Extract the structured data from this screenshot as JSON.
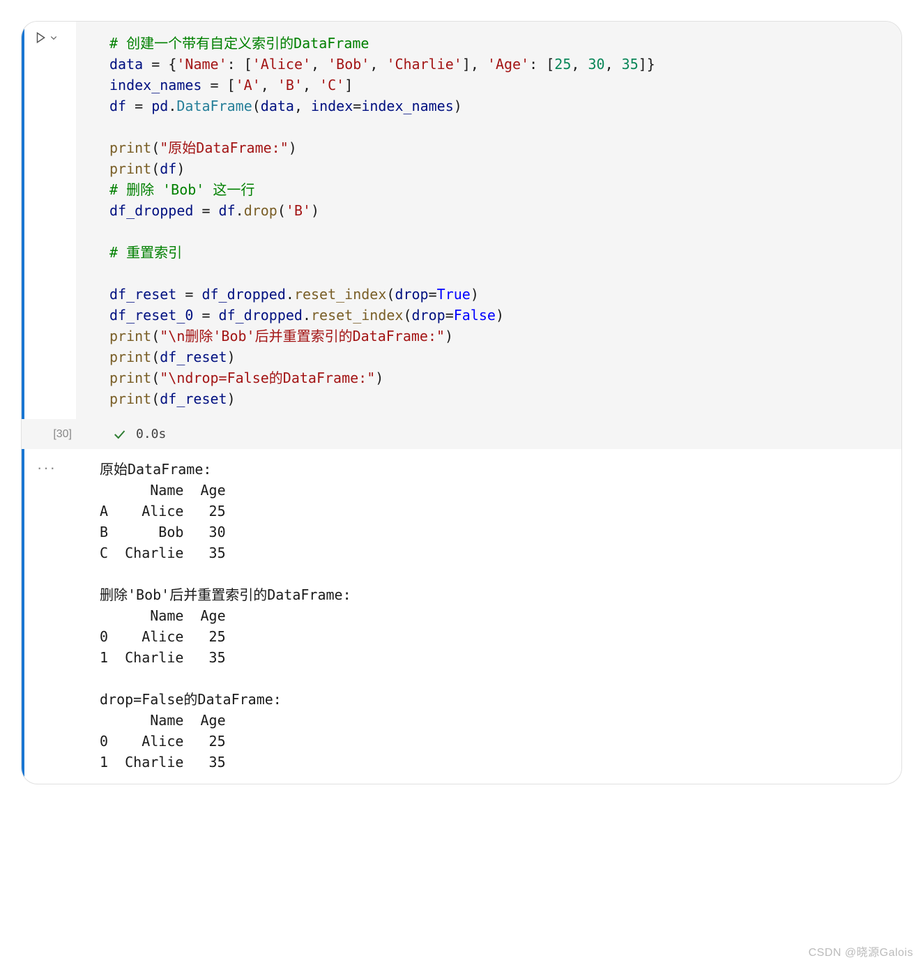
{
  "cell": {
    "exec_count": "[30]",
    "exec_time": "0.0s",
    "ellipsis": "···",
    "code_lines": [
      [
        {
          "t": "# 创建一个带有自定义索引的DataFrame",
          "c": "c-comment"
        }
      ],
      [
        {
          "t": "data ",
          "c": "c-attr"
        },
        {
          "t": "= ",
          "c": "c-op"
        },
        {
          "t": "{",
          "c": "c-punct"
        },
        {
          "t": "'Name'",
          "c": "c-str"
        },
        {
          "t": ": [",
          "c": "c-punct"
        },
        {
          "t": "'Alice'",
          "c": "c-str"
        },
        {
          "t": ", ",
          "c": "c-punct"
        },
        {
          "t": "'Bob'",
          "c": "c-str"
        },
        {
          "t": ", ",
          "c": "c-punct"
        },
        {
          "t": "'Charlie'",
          "c": "c-str"
        },
        {
          "t": "], ",
          "c": "c-punct"
        },
        {
          "t": "'Age'",
          "c": "c-str"
        },
        {
          "t": ": [",
          "c": "c-punct"
        },
        {
          "t": "25",
          "c": "c-num"
        },
        {
          "t": ", ",
          "c": "c-punct"
        },
        {
          "t": "30",
          "c": "c-num"
        },
        {
          "t": ", ",
          "c": "c-punct"
        },
        {
          "t": "35",
          "c": "c-num"
        },
        {
          "t": "]}",
          "c": "c-punct"
        }
      ],
      [
        {
          "t": "index_names ",
          "c": "c-attr"
        },
        {
          "t": "= ",
          "c": "c-op"
        },
        {
          "t": "[",
          "c": "c-punct"
        },
        {
          "t": "'A'",
          "c": "c-str"
        },
        {
          "t": ", ",
          "c": "c-punct"
        },
        {
          "t": "'B'",
          "c": "c-str"
        },
        {
          "t": ", ",
          "c": "c-punct"
        },
        {
          "t": "'C'",
          "c": "c-str"
        },
        {
          "t": "]",
          "c": "c-punct"
        }
      ],
      [
        {
          "t": "df ",
          "c": "c-attr"
        },
        {
          "t": "= ",
          "c": "c-op"
        },
        {
          "t": "pd",
          "c": "c-attr"
        },
        {
          "t": ".",
          "c": "c-punct"
        },
        {
          "t": "DataFrame",
          "c": "c-builtin"
        },
        {
          "t": "(",
          "c": "c-punct"
        },
        {
          "t": "data",
          "c": "c-attr"
        },
        {
          "t": ", ",
          "c": "c-punct"
        },
        {
          "t": "index",
          "c": "c-attr"
        },
        {
          "t": "=",
          "c": "c-op"
        },
        {
          "t": "index_names",
          "c": "c-attr"
        },
        {
          "t": ")",
          "c": "c-punct"
        }
      ],
      [
        {
          "t": "",
          "c": "c-ident"
        }
      ],
      [
        {
          "t": "print",
          "c": "c-func"
        },
        {
          "t": "(",
          "c": "c-punct"
        },
        {
          "t": "\"原始DataFrame:\"",
          "c": "c-str"
        },
        {
          "t": ")",
          "c": "c-punct"
        }
      ],
      [
        {
          "t": "print",
          "c": "c-func"
        },
        {
          "t": "(",
          "c": "c-punct"
        },
        {
          "t": "df",
          "c": "c-attr"
        },
        {
          "t": ")",
          "c": "c-punct"
        }
      ],
      [
        {
          "t": "# 删除 'Bob' 这一行",
          "c": "c-comment"
        }
      ],
      [
        {
          "t": "df_dropped ",
          "c": "c-attr"
        },
        {
          "t": "= ",
          "c": "c-op"
        },
        {
          "t": "df",
          "c": "c-attr"
        },
        {
          "t": ".",
          "c": "c-punct"
        },
        {
          "t": "drop",
          "c": "c-func"
        },
        {
          "t": "(",
          "c": "c-punct"
        },
        {
          "t": "'B'",
          "c": "c-str"
        },
        {
          "t": ")",
          "c": "c-punct"
        }
      ],
      [
        {
          "t": "",
          "c": "c-ident"
        }
      ],
      [
        {
          "t": "# 重置索引",
          "c": "c-comment"
        }
      ],
      [
        {
          "t": "",
          "c": "c-ident"
        }
      ],
      [
        {
          "t": "df_reset ",
          "c": "c-attr"
        },
        {
          "t": "= ",
          "c": "c-op"
        },
        {
          "t": "df_dropped",
          "c": "c-attr"
        },
        {
          "t": ".",
          "c": "c-punct"
        },
        {
          "t": "reset_index",
          "c": "c-func"
        },
        {
          "t": "(",
          "c": "c-punct"
        },
        {
          "t": "drop",
          "c": "c-attr"
        },
        {
          "t": "=",
          "c": "c-op"
        },
        {
          "t": "True",
          "c": "c-kw"
        },
        {
          "t": ")",
          "c": "c-punct"
        }
      ],
      [
        {
          "t": "df_reset_0 ",
          "c": "c-attr"
        },
        {
          "t": "= ",
          "c": "c-op"
        },
        {
          "t": "df_dropped",
          "c": "c-attr"
        },
        {
          "t": ".",
          "c": "c-punct"
        },
        {
          "t": "reset_index",
          "c": "c-func"
        },
        {
          "t": "(",
          "c": "c-punct"
        },
        {
          "t": "drop",
          "c": "c-attr"
        },
        {
          "t": "=",
          "c": "c-op"
        },
        {
          "t": "False",
          "c": "c-kw"
        },
        {
          "t": ")",
          "c": "c-punct"
        }
      ],
      [
        {
          "t": "print",
          "c": "c-func"
        },
        {
          "t": "(",
          "c": "c-punct"
        },
        {
          "t": "\"\\n删除'Bob'后并重置索引的DataFrame:\"",
          "c": "c-str"
        },
        {
          "t": ")",
          "c": "c-punct"
        }
      ],
      [
        {
          "t": "print",
          "c": "c-func"
        },
        {
          "t": "(",
          "c": "c-punct"
        },
        {
          "t": "df_reset",
          "c": "c-attr"
        },
        {
          "t": ")",
          "c": "c-punct"
        }
      ],
      [
        {
          "t": "print",
          "c": "c-func"
        },
        {
          "t": "(",
          "c": "c-punct"
        },
        {
          "t": "\"\\ndrop=False的DataFrame:\"",
          "c": "c-str"
        },
        {
          "t": ")",
          "c": "c-punct"
        }
      ],
      [
        {
          "t": "print",
          "c": "c-func"
        },
        {
          "t": "(",
          "c": "c-punct"
        },
        {
          "t": "df_reset",
          "c": "c-attr"
        },
        {
          "t": ")",
          "c": "c-punct"
        }
      ]
    ],
    "output_text": "原始DataFrame:\n      Name  Age\nA    Alice   25\nB      Bob   30\nC  Charlie   35\n\n删除'Bob'后并重置索引的DataFrame:\n      Name  Age\n0    Alice   25\n1  Charlie   35\n\ndrop=False的DataFrame:\n      Name  Age\n0    Alice   25\n1  Charlie   35"
  },
  "watermark": "CSDN @晓源Galois"
}
